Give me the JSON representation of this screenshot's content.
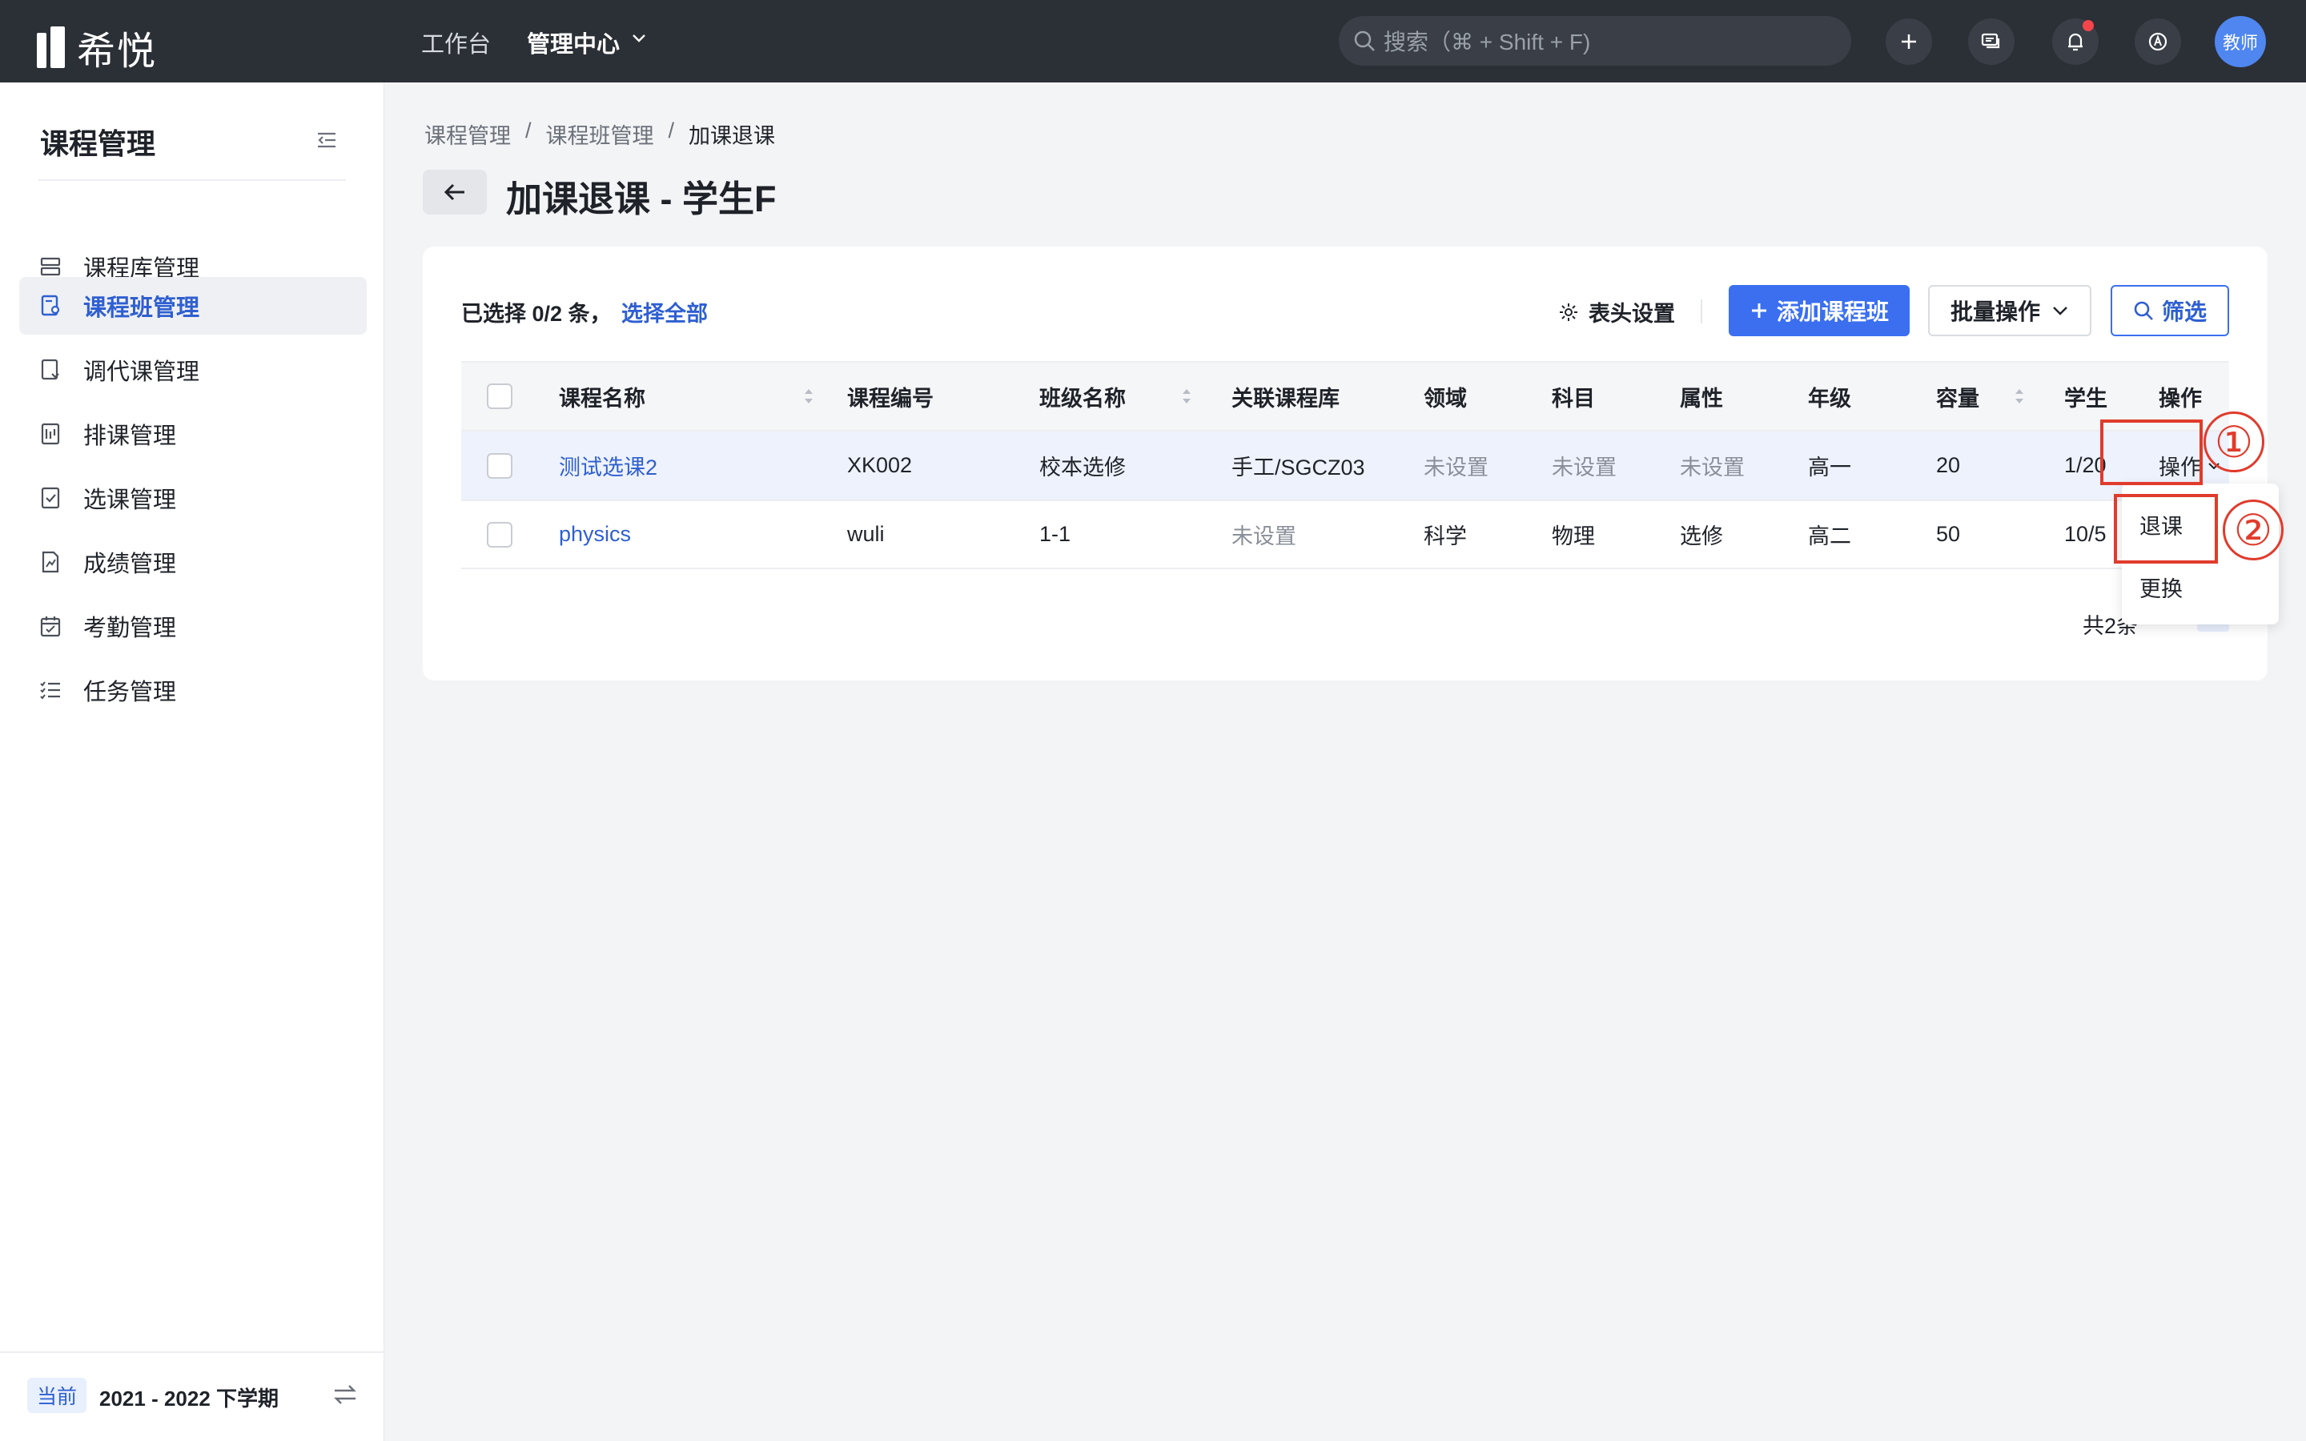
{
  "app": {
    "logo_text": "希悦"
  },
  "topnav": {
    "items": [
      {
        "label": "工作台",
        "active": false
      },
      {
        "label": "管理中心",
        "active": true
      }
    ]
  },
  "search": {
    "placeholder": "搜索（⌘ + Shift + F)"
  },
  "user": {
    "avatar_label": "教师"
  },
  "sidebar": {
    "title": "课程管理",
    "items": [
      {
        "label": "课程库管理",
        "icon": "course-library-icon",
        "active": false
      },
      {
        "label": "课程班管理",
        "icon": "course-class-icon",
        "active": true
      },
      {
        "label": "调代课管理",
        "icon": "substitute-icon",
        "active": false
      },
      {
        "label": "排课管理",
        "icon": "schedule-icon",
        "active": false
      },
      {
        "label": "选课管理",
        "icon": "selection-icon",
        "active": false
      },
      {
        "label": "成绩管理",
        "icon": "grades-icon",
        "active": false
      },
      {
        "label": "考勤管理",
        "icon": "attendance-icon",
        "active": false
      },
      {
        "label": "任务管理",
        "icon": "task-list-icon",
        "active": false
      }
    ],
    "term_badge": "当前",
    "term": "2021 - 2022 下学期"
  },
  "breadcrumb": [
    "课程管理",
    "课程班管理",
    "加课退课"
  ],
  "page": {
    "title": "加课退课 - 学生F"
  },
  "toolbar": {
    "selection": "已选择 0/2 条，",
    "select_all": "选择全部",
    "column_settings": "表头设置",
    "add_button": "添加课程班",
    "batch_button": "批量操作",
    "filter_button": "筛选"
  },
  "table": {
    "columns": [
      "课程名称",
      "课程编号",
      "班级名称",
      "关联课程库",
      "领域",
      "科目",
      "属性",
      "年级",
      "容量",
      "学生",
      "操作"
    ],
    "rows": [
      {
        "name": "测试选课2",
        "code": "XK002",
        "class": "校本选修",
        "library": "手工/SGCZ03",
        "field": "未设置",
        "subject": "未设置",
        "attr": "未设置",
        "grade": "高一",
        "capacity": "20",
        "students": "1/20",
        "action": "操作"
      },
      {
        "name": "physics",
        "code": "wuli",
        "class": "1-1",
        "library": "未设置",
        "field": "科学",
        "subject": "物理",
        "attr": "选修",
        "grade": "高二",
        "capacity": "50",
        "students": "10/5",
        "action": ""
      }
    ],
    "total": "共2条"
  },
  "dropdown": {
    "items": [
      "退课",
      "更换"
    ]
  },
  "annotations": {
    "step1": "①",
    "step2": "②",
    "color": "#e03b2c"
  },
  "colors": {
    "accent": "#3b6ff0",
    "topbar": "#2b2f36",
    "link": "#2f5fd0"
  }
}
